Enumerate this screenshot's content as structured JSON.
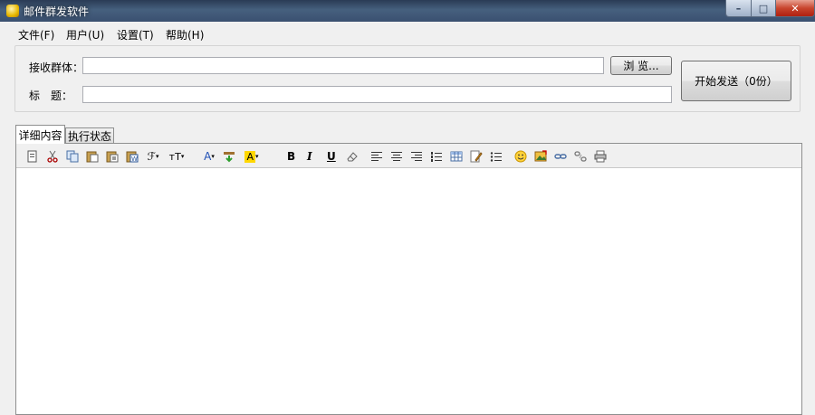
{
  "window": {
    "title": "邮件群发软件"
  },
  "menu": {
    "items": [
      "文件(F)",
      "用户(U)",
      "设置(T)",
      "帮助(H)"
    ]
  },
  "form": {
    "recipients_label": "接收群体：",
    "recipients_value": "",
    "subject_label": "标　题：",
    "subject_value": "",
    "browse_label": "浏 览...",
    "send_label": "开始发送（0份）"
  },
  "tabs": [
    "详细内容",
    "执行状态"
  ],
  "toolbar": {
    "icons": [
      "new-document-icon",
      "cut-icon",
      "copy-icon",
      "paste-icon",
      "paste-text-icon",
      "paste-word-icon",
      "font-family-icon",
      "font-size-icon",
      "font-color-icon",
      "insert-icon",
      "highlight-icon",
      "bold-icon",
      "italic-icon",
      "underline-icon",
      "eraser-icon",
      "align-left-icon",
      "align-center-icon",
      "align-right-icon",
      "ordered-list-icon",
      "table-icon",
      "edit-icon",
      "unordered-list-icon",
      "emoticon-icon",
      "image-icon",
      "link-icon",
      "unlink-icon",
      "print-icon"
    ],
    "bold_glyph": "B",
    "italic_glyph": "I",
    "underline_glyph": "U",
    "font_glyph": "ℱ",
    "size_glyph": "тT",
    "color_glyph": "A"
  },
  "colors": {
    "highlight": "#ffd700",
    "accent_insert": "#2e9e2e"
  }
}
